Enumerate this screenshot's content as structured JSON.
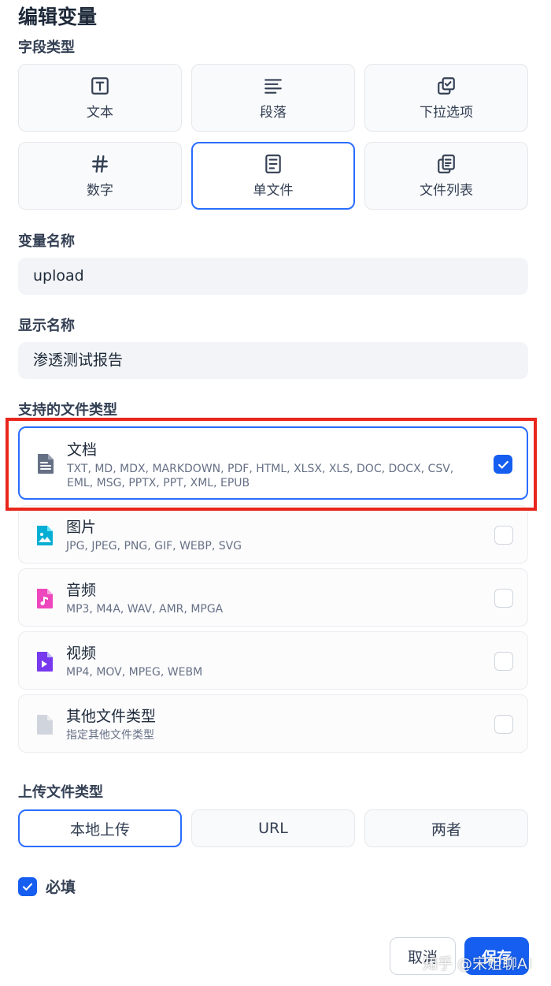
{
  "dialog": {
    "title": "编辑变量"
  },
  "field_type": {
    "label": "字段类型",
    "options": [
      {
        "label": "文本",
        "icon": "text-box-icon",
        "selected": false
      },
      {
        "label": "段落",
        "icon": "paragraph-lines-icon",
        "selected": false
      },
      {
        "label": "下拉选项",
        "icon": "checked-copy-icon",
        "selected": false
      },
      {
        "label": "数字",
        "icon": "hash-icon",
        "selected": false
      },
      {
        "label": "单文件",
        "icon": "document-icon",
        "selected": true
      },
      {
        "label": "文件列表",
        "icon": "document-copy-icon",
        "selected": false
      }
    ]
  },
  "variable_name": {
    "label": "变量名称",
    "value": "upload"
  },
  "display_name": {
    "label": "显示名称",
    "value": "渗透测试报告"
  },
  "file_types": {
    "label": "支持的文件类型",
    "items": [
      {
        "name": "文档",
        "exts": "TXT, MD, MDX, MARKDOWN, PDF, HTML, XLSX, XLS, DOC, DOCX, CSV, EML, MSG, PPTX, PPT, XML, EPUB",
        "checked": true,
        "icon": "document-file-icon",
        "color": "#667085"
      },
      {
        "name": "图片",
        "exts": "JPG, JPEG, PNG, GIF, WEBP, SVG",
        "checked": false,
        "icon": "image-file-icon",
        "color": "#06aed4"
      },
      {
        "name": "音频",
        "exts": "MP3, M4A, WAV, AMR, MPGA",
        "checked": false,
        "icon": "audio-file-icon",
        "color": "#ee46bc"
      },
      {
        "name": "视频",
        "exts": "MP4, MOV, MPEG, WEBM",
        "checked": false,
        "icon": "video-file-icon",
        "color": "#7839ee"
      },
      {
        "name": "其他文件类型",
        "exts": "指定其他文件类型",
        "checked": false,
        "icon": "other-file-icon",
        "color": "#d0d5dd"
      }
    ]
  },
  "upload_method": {
    "label": "上传文件类型",
    "options": [
      {
        "label": "本地上传",
        "selected": true
      },
      {
        "label": "URL",
        "selected": false
      },
      {
        "label": "两者",
        "selected": false
      }
    ]
  },
  "required": {
    "label": "必填",
    "checked": true
  },
  "footer": {
    "cancel_label": "取消",
    "save_label": "保存"
  },
  "watermark": "知乎 @宋姐聊AI",
  "colors": {
    "accent": "#155eef",
    "selected_border": "#296dff",
    "highlight_box": "#e8261c"
  }
}
